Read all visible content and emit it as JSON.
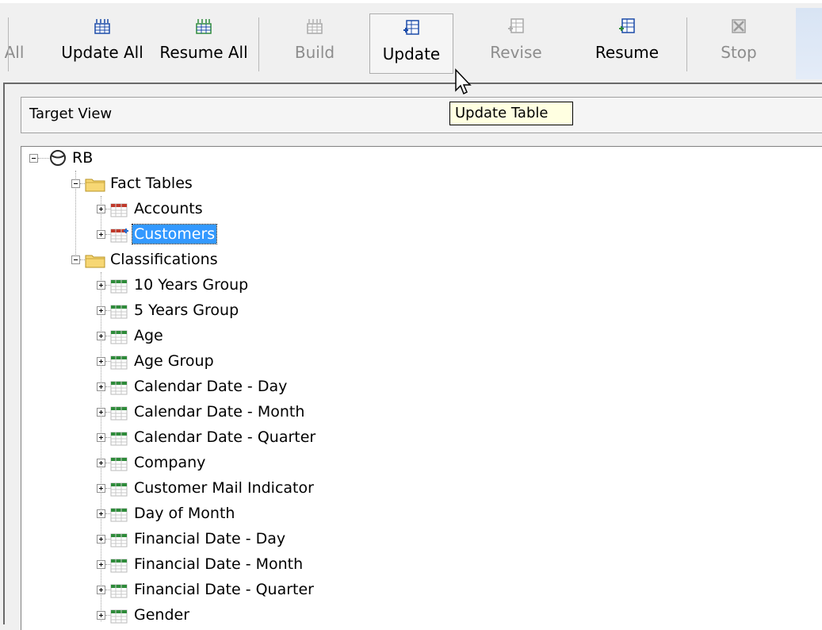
{
  "toolbar": {
    "partial_label": "All",
    "buttons": [
      {
        "label": "Update All",
        "icon": "table-update-all-icon",
        "enabled": true
      },
      {
        "label": "Resume All",
        "icon": "table-resume-all-icon",
        "enabled": true
      },
      {
        "label": "Build",
        "icon": "table-build-icon",
        "enabled": false
      },
      {
        "label": "Update",
        "icon": "table-update-icon",
        "enabled": true
      },
      {
        "label": "Revise",
        "icon": "table-revise-icon",
        "enabled": false
      },
      {
        "label": "Resume",
        "icon": "table-resume-icon",
        "enabled": true
      },
      {
        "label": "Stop",
        "icon": "stop-icon",
        "enabled": false
      }
    ]
  },
  "tooltip": "Update Table",
  "panel": {
    "title": "Target View"
  },
  "tree": {
    "root": "RB",
    "groups": [
      {
        "label": "Fact Tables",
        "items": [
          "Accounts",
          "Customers"
        ],
        "selected": "Customers",
        "table_color": "#c0392b"
      },
      {
        "label": "Classifications",
        "items": [
          "10 Years Group",
          "5 Years Group",
          "Age",
          "Age Group",
          "Calendar Date - Day",
          "Calendar Date - Month",
          "Calendar Date - Quarter",
          "Company",
          "Customer Mail Indicator",
          "Day of Month",
          "Financial Date - Day",
          "Financial Date - Month",
          "Financial Date - Quarter",
          "Gender"
        ],
        "table_color": "#2e8b3a"
      }
    ]
  },
  "colors": {
    "selection": "#3399ff",
    "tooltip_bg": "#ffffe1"
  }
}
